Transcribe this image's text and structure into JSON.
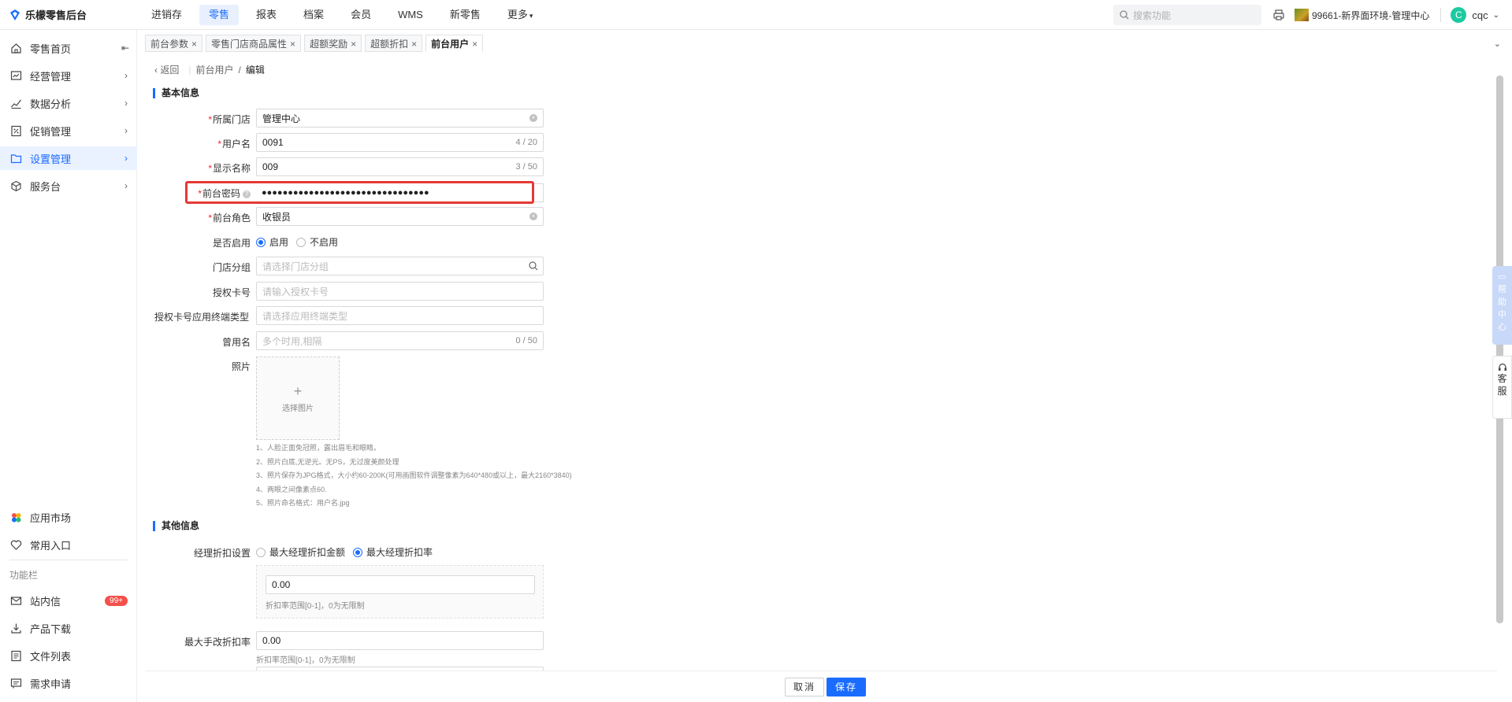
{
  "app": {
    "title": "乐檬零售后台"
  },
  "topnav": {
    "items": [
      "进销存",
      "零售",
      "报表",
      "档案",
      "会员",
      "WMS",
      "新零售",
      "更多"
    ],
    "active": "零售"
  },
  "search": {
    "placeholder": "搜索功能"
  },
  "store": {
    "name": "99661-新界面环境-管理中心"
  },
  "user": {
    "avatar_letter": "C",
    "name": "cqc"
  },
  "sidebar": {
    "items": [
      {
        "label": "零售首页",
        "icon": "home-icon"
      },
      {
        "label": "经营管理",
        "icon": "chart-board-icon"
      },
      {
        "label": "数据分析",
        "icon": "trend-icon"
      },
      {
        "label": "促销管理",
        "icon": "promo-icon"
      },
      {
        "label": "设置管理",
        "icon": "folder-icon"
      },
      {
        "label": "服务台",
        "icon": "cube-icon"
      }
    ],
    "bottom_items": [
      {
        "label": "应用市场",
        "icon": "app-market-icon"
      },
      {
        "label": "常用入口",
        "icon": "heart-icon"
      }
    ],
    "function_label": "功能栏",
    "function_items": [
      {
        "label": "站内信",
        "icon": "mail-icon",
        "badge": "99+"
      },
      {
        "label": "产品下载",
        "icon": "download-icon"
      },
      {
        "label": "文件列表",
        "icon": "file-list-icon"
      },
      {
        "label": "需求申请",
        "icon": "request-icon"
      }
    ]
  },
  "tabs": [
    {
      "label": "前台参数"
    },
    {
      "label": "零售门店商品属性"
    },
    {
      "label": "超额奖励"
    },
    {
      "label": "超额折扣"
    },
    {
      "label": "前台用户",
      "active": true
    }
  ],
  "breadcrumb": {
    "back": "返回",
    "parent": "前台用户",
    "sep": "/",
    "current": "编辑"
  },
  "basic": {
    "title": "基本信息",
    "store_label": "所属门店",
    "store_value": "管理中心",
    "username_label": "用户名",
    "username_value": "0091",
    "username_count": "4 / 20",
    "display_label": "显示名称",
    "display_value": "009",
    "display_count": "3 / 50",
    "password_label": "前台密码",
    "password_value": "●●●●●●●●●●●●●●●●●●●●●●●●●●●●●●●●",
    "role_label": "前台角色",
    "role_value": "收银员",
    "enabled_label": "是否启用",
    "enabled_on": "启用",
    "enabled_off": "不启用",
    "group_label": "门店分组",
    "group_placeholder": "请选择门店分组",
    "card_label": "授权卡号",
    "card_placeholder": "请输入授权卡号",
    "card_type_label": "授权卡号应用终端类型",
    "card_type_placeholder": "请选择应用终端类型",
    "alias_label": "曾用名",
    "alias_placeholder": "多个时用,相隔",
    "alias_count": "0 / 50",
    "photo_label": "照片",
    "photo_button": "选择图片",
    "photo_notes": [
      "1、人脸正面免冠照，露出眉毛和眼睛。",
      "2、照片白底,无逆光。无PS，无过度美颜处理",
      "3、照片保存为JPG格式，大小约60-200K(可用画图软件调整像素为640*480或以上，最大2160*3840)",
      "4、两眼之间像素点60.",
      "5、照片命名格式：用户名.jpg"
    ]
  },
  "other": {
    "title": "其他信息",
    "manager_label": "经理折扣设置",
    "opt_amount": "最大经理折扣金额",
    "opt_rate": "最大经理折扣率",
    "manager_value": "0.00",
    "manager_hint": "折扣率范围[0-1]，0为无限制",
    "manual_label": "最大手改折扣率",
    "manual_value": "0.00",
    "manual_hint": "折扣率范围[0-1]，0为无限制"
  },
  "footer": {
    "cancel": "取消",
    "save": "保存"
  },
  "float": {
    "help": [
      "帮",
      "助",
      "中",
      "心"
    ],
    "cs": [
      "客",
      "服"
    ]
  },
  "colors": {
    "accent": "#1a6cff",
    "highlight": "#e53935",
    "badge": "#f5504a"
  }
}
